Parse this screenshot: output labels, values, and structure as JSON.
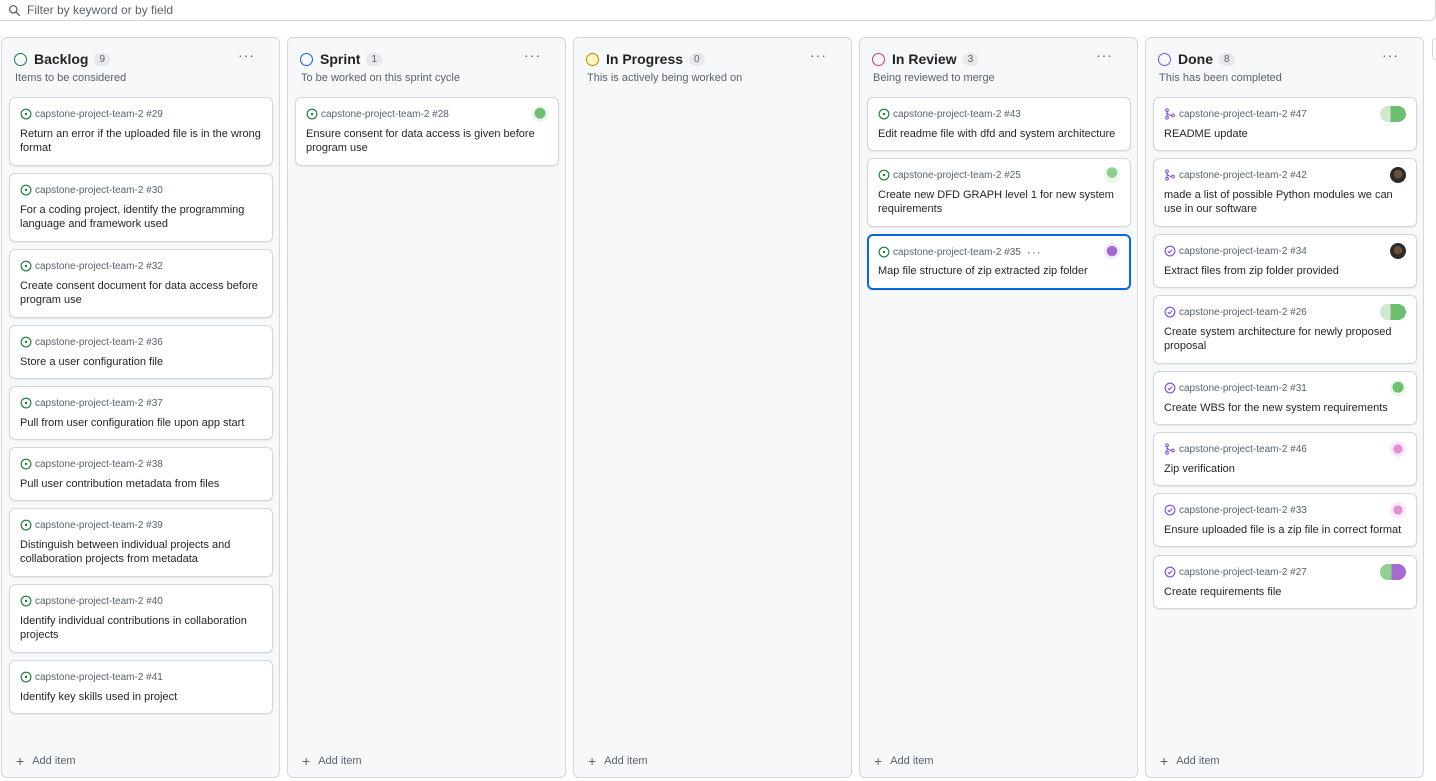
{
  "filter": {
    "placeholder": "Filter by keyword or by field"
  },
  "colors": {
    "open_issue": "#1a7f37",
    "closed_issue": "#8250df",
    "pull_request": "#8250df",
    "accent": "#0969da"
  },
  "columns": [
    {
      "title": "Backlog",
      "count": "9",
      "description": "Items to be considered",
      "status_color": "#1a7f37",
      "add_label": "Add item",
      "cards": [
        {
          "ref": "capstone-project-team-2 #29",
          "title": "Return an error if the uploaded file is in the wrong format",
          "icon": "open-issue-icon"
        },
        {
          "ref": "capstone-project-team-2 #30",
          "title": "For a coding project, identify the programming language and framework used",
          "icon": "open-issue-icon"
        },
        {
          "ref": "capstone-project-team-2 #32",
          "title": "Create consent document for data access before program use",
          "icon": "open-issue-icon"
        },
        {
          "ref": "capstone-project-team-2 #36",
          "title": "Store a user configuration file",
          "icon": "open-issue-icon"
        },
        {
          "ref": "capstone-project-team-2 #37",
          "title": "Pull from user configuration file upon app start",
          "icon": "open-issue-icon"
        },
        {
          "ref": "capstone-project-team-2 #38",
          "title": "Pull user contribution metadata from files",
          "icon": "open-issue-icon"
        },
        {
          "ref": "capstone-project-team-2 #39",
          "title": "Distinguish between individual projects and collaboration projects from metadata",
          "icon": "open-issue-icon"
        },
        {
          "ref": "capstone-project-team-2 #40",
          "title": "Identify individual contributions in collaboration projects",
          "icon": "open-issue-icon"
        },
        {
          "ref": "capstone-project-team-2 #41",
          "title": "Identify key skills used in project",
          "icon": "open-issue-icon"
        }
      ]
    },
    {
      "title": "Sprint",
      "count": "1",
      "description": "To be worked on this sprint cycle",
      "status_color": "#0969da",
      "add_label": "Add item",
      "cards": [
        {
          "ref": "capstone-project-team-2 #28",
          "title": "Ensure consent for data access is given before program use",
          "icon": "open-issue-icon"
        }
      ]
    },
    {
      "title": "In Progress",
      "count": "0",
      "description": "This is actively being worked on",
      "status_color": "#bf8700",
      "add_label": "Add item",
      "cards": []
    },
    {
      "title": "In Review",
      "count": "3",
      "description": "Being reviewed to merge",
      "status_color": "#bf3989",
      "add_label": "Add item",
      "cards": [
        {
          "ref": "capstone-project-team-2 #43",
          "title": "Edit readme file with dfd and system architecture",
          "icon": "open-issue-icon"
        },
        {
          "ref": "capstone-project-team-2 #25",
          "title": "Create new DFD GRAPH level 1 for new system requirements",
          "icon": "open-issue-icon"
        },
        {
          "ref": "capstone-project-team-2 #35",
          "title": "Map file structure of zip extracted zip folder",
          "icon": "open-issue-icon"
        }
      ]
    },
    {
      "title": "Done",
      "count": "8",
      "description": "This has been completed",
      "status_color": "#8250df",
      "add_label": "Add item",
      "cards": [
        {
          "ref": "capstone-project-team-2 #47",
          "title": "README update",
          "icon": "merged-pr-icon"
        },
        {
          "ref": "capstone-project-team-2 #42",
          "title": "made a list of possible Python modules we can use in our software",
          "icon": "merged-pr-icon"
        },
        {
          "ref": "capstone-project-team-2 #34",
          "title": "Extract files from zip folder provided",
          "icon": "closed-issue-icon"
        },
        {
          "ref": "capstone-project-team-2 #26",
          "title": "Create system architecture for newly proposed proposal",
          "icon": "closed-issue-icon"
        },
        {
          "ref": "capstone-project-team-2 #31",
          "title": "Create WBS for the new system requirements",
          "icon": "closed-issue-icon"
        },
        {
          "ref": "capstone-project-team-2 #46",
          "title": "Zip verification",
          "icon": "merged-pr-icon"
        },
        {
          "ref": "capstone-project-team-2 #33",
          "title": "Ensure uploaded file is a zip file in correct format",
          "icon": "closed-issue-icon"
        },
        {
          "ref": "capstone-project-team-2 #27",
          "title": "Create requirements file",
          "icon": "closed-issue-icon"
        }
      ]
    }
  ]
}
